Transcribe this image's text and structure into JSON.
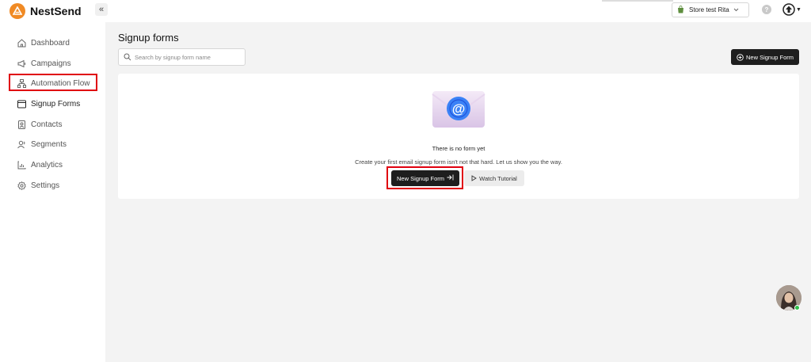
{
  "app": {
    "name": "NestSend"
  },
  "header": {
    "collapse_label": "«",
    "store": {
      "name": "Store test Rita",
      "icon": "shopify-bag-icon"
    },
    "help_label": "?",
    "account_icon": "user-menu-icon"
  },
  "sidebar": {
    "items": [
      {
        "label": "Dashboard",
        "icon": "home-icon"
      },
      {
        "label": "Campaigns",
        "icon": "megaphone-icon"
      },
      {
        "label": "Automation Flow",
        "icon": "flow-icon"
      },
      {
        "label": "Signup Forms",
        "icon": "form-icon",
        "active": true
      },
      {
        "label": "Contacts",
        "icon": "contacts-icon"
      },
      {
        "label": "Segments",
        "icon": "segments-icon"
      },
      {
        "label": "Analytics",
        "icon": "analytics-icon"
      },
      {
        "label": "Settings",
        "icon": "gear-icon"
      }
    ]
  },
  "main": {
    "title": "Signup forms",
    "search_placeholder": "Search by signup form name",
    "new_button_label": "New Signup Form",
    "empty_state": {
      "title": "There is no form yet",
      "description": "Create your first email signup form isn't not that hard. Let us show you the way.",
      "primary_label": "New Signup Form",
      "secondary_label": "Watch Tutorial"
    }
  },
  "colors": {
    "brand": "#f08a24",
    "dark_button": "#1e1e1e",
    "highlight": "#e0000f",
    "envelope_accent": "#3b82f6"
  }
}
